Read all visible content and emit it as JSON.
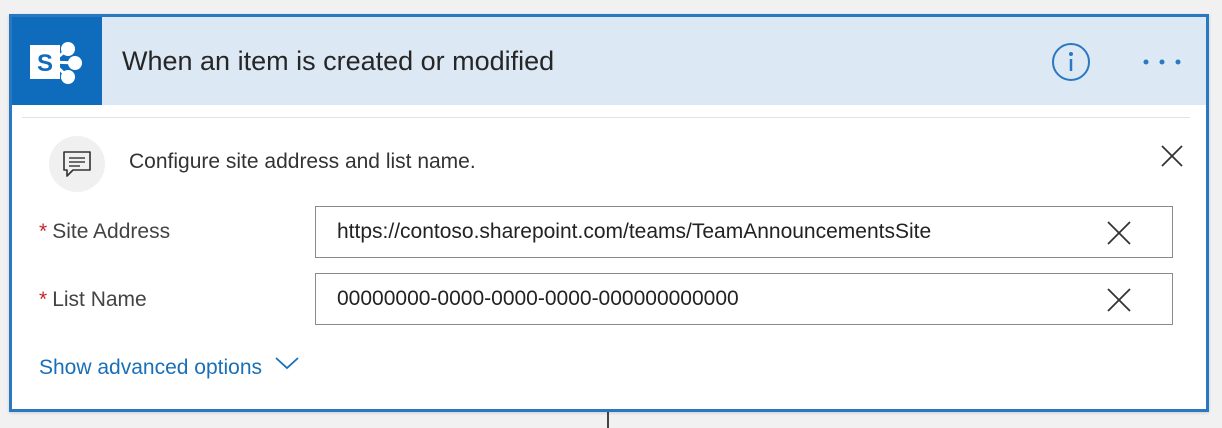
{
  "trigger": {
    "title": "When an item is created or modified",
    "app_icon": "sharepoint-icon",
    "app_icon_letter": "S",
    "info_icon": "info-icon",
    "more_icon": "more-options-icon"
  },
  "banner": {
    "icon": "comment-icon",
    "message": "Configure site address and list name.",
    "close_icon": "close-icon"
  },
  "fields": {
    "site_address": {
      "label": "Site Address",
      "required_mark": "*",
      "value": "https://contoso.sharepoint.com/teams/TeamAnnouncementsSite"
    },
    "list_name": {
      "label": "List Name",
      "required_mark": "*",
      "value": "00000000-0000-0000-0000-000000000000"
    }
  },
  "advanced": {
    "label": "Show advanced options",
    "icon": "chevron-down-icon"
  },
  "colors": {
    "accent": "#2b78c2",
    "header_bg": "#dce8f4",
    "sharepoint_blue": "#0f6cbd",
    "link": "#1a6fb8",
    "required": "#c4262e"
  }
}
